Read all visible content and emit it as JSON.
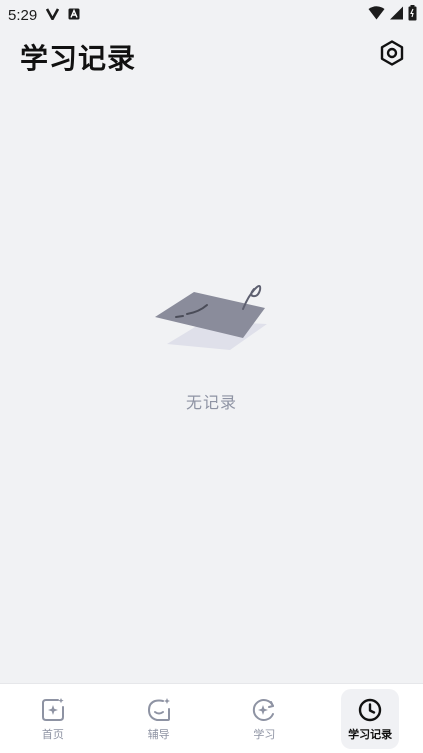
{
  "status_bar": {
    "time": "5:29",
    "left_icons": [
      "v-notification-icon",
      "a-notification-icon"
    ],
    "right_icons": [
      "wifi-icon",
      "cellular-signal-icon",
      "battery-icon"
    ]
  },
  "header": {
    "title": "学习记录",
    "settings_icon": "settings-icon"
  },
  "empty_state": {
    "text": "无记录",
    "illustration": "empty-paper-icon"
  },
  "tabbar": {
    "tabs": [
      {
        "label": "首页",
        "icon": "home-icon",
        "active": false
      },
      {
        "label": "辅导",
        "icon": "tutoring-icon",
        "active": false
      },
      {
        "label": "学习",
        "icon": "study-icon",
        "active": false
      },
      {
        "label": "学习记录",
        "icon": "clock-icon",
        "active": true
      }
    ]
  },
  "colors": {
    "background": "#f1f2f4",
    "inactive_tab": "#8e93a3",
    "active_tab": "#111111",
    "illustration": "#8a8c9b"
  }
}
